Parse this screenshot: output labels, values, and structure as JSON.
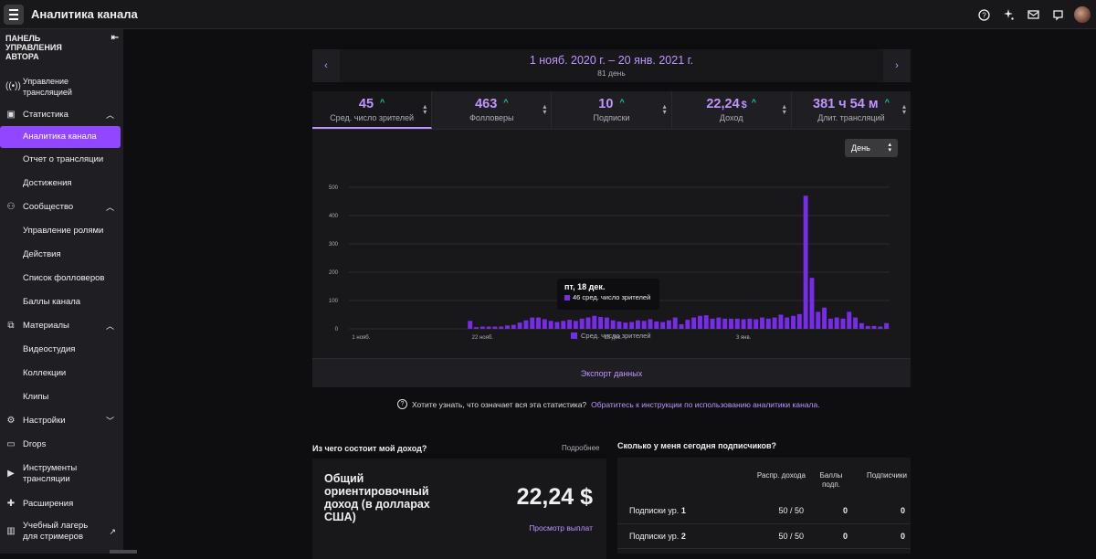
{
  "app": {
    "title": "Аналитика канала"
  },
  "sidebar": {
    "heading": "ПАНЕЛЬ УПРАВЛЕНИЯ АВТОРА",
    "sections": [
      {
        "label": "Управление трансляцией"
      },
      {
        "label": "Статистика",
        "children": [
          "Аналитика канала",
          "Отчет о трансляции",
          "Достижения"
        ]
      },
      {
        "label": "Сообщество",
        "children": [
          "Управление ролями",
          "Действия",
          "Список фолловеров",
          "Баллы канала"
        ]
      },
      {
        "label": "Материалы",
        "children": [
          "Видеостудия",
          "Коллекции",
          "Клипы"
        ]
      },
      {
        "label": "Настройки"
      },
      {
        "label": "Drops"
      },
      {
        "label": "Инструменты трансляции"
      },
      {
        "label": "Расширения"
      },
      {
        "label": "Учебный лагерь для стримеров"
      }
    ]
  },
  "date_nav": {
    "range": "1 нояб. 2020 г. – 20 янв. 2021 г.",
    "days": "81 день"
  },
  "tabs": [
    {
      "value": "45",
      "unit": "",
      "label": "Сред. число зрителей",
      "active": true
    },
    {
      "value": "463",
      "unit": "",
      "label": "Фолловеры",
      "active": false
    },
    {
      "value": "10",
      "unit": "",
      "label": "Подписки",
      "active": false
    },
    {
      "value": "22,24",
      "unit": "$",
      "label": "Доход",
      "active": false
    },
    {
      "value": "381 ч 54 м",
      "unit": "",
      "label": "Длит. трансляций",
      "active": false
    }
  ],
  "period_select": {
    "value": "День"
  },
  "chart_data": {
    "type": "bar",
    "x_tick_labels": [
      "1 нояб.",
      "22 нояб.",
      "13 дек.",
      "3 янв."
    ],
    "y_ticks": [
      0,
      100,
      200,
      300,
      400,
      500
    ],
    "ylim": [
      0,
      500
    ],
    "series": [
      {
        "name": "Сред. число зрителей",
        "color": "#772ce8",
        "values": [
          0,
          0,
          0,
          0,
          0,
          0,
          0,
          0,
          0,
          0,
          0,
          0,
          0,
          0,
          0,
          0,
          0,
          0,
          0,
          28,
          6,
          8,
          8,
          8,
          8,
          12,
          14,
          22,
          30,
          40,
          40,
          34,
          28,
          24,
          28,
          32,
          28,
          36,
          40,
          46,
          42,
          40,
          30,
          26,
          22,
          24,
          30,
          28,
          34,
          26,
          24,
          30,
          40,
          16,
          32,
          40,
          46,
          48,
          36,
          40,
          36,
          36,
          36,
          34,
          36,
          34,
          40,
          36,
          40,
          50,
          40,
          46,
          52,
          470,
          180,
          60,
          75,
          36,
          40,
          36,
          60,
          40,
          20,
          10,
          10,
          8,
          20
        ]
      }
    ]
  },
  "tooltip": {
    "date": "пт, 18 дек.",
    "text": "46 сред. число зрителей"
  },
  "export_label": "Экспорт данных",
  "help": {
    "question": "Хотите узнать, что означает вся эта статистика?",
    "link": "Обратитесь к инструкции по использованию аналитики канала."
  },
  "income": {
    "section_title": "Из чего состоит мой доход?",
    "more": "Подробнее",
    "label": "Общий ориентировочный доход (в долларах США)",
    "value": "22,24 $",
    "payouts": "Просмотр выплат"
  },
  "subs": {
    "section_title": "Сколько у меня сегодня подписчиков?",
    "headers": [
      "Распр. дохода",
      "Баллы подп.",
      "Подписчики"
    ],
    "rows": [
      {
        "name": "Подписки ур. ",
        "tier": "1",
        "split": "50 / 50",
        "points": "0",
        "subs": "0"
      },
      {
        "name": "Подписки ур. ",
        "tier": "2",
        "split": "50 / 50",
        "points": "0",
        "subs": "0"
      }
    ]
  }
}
